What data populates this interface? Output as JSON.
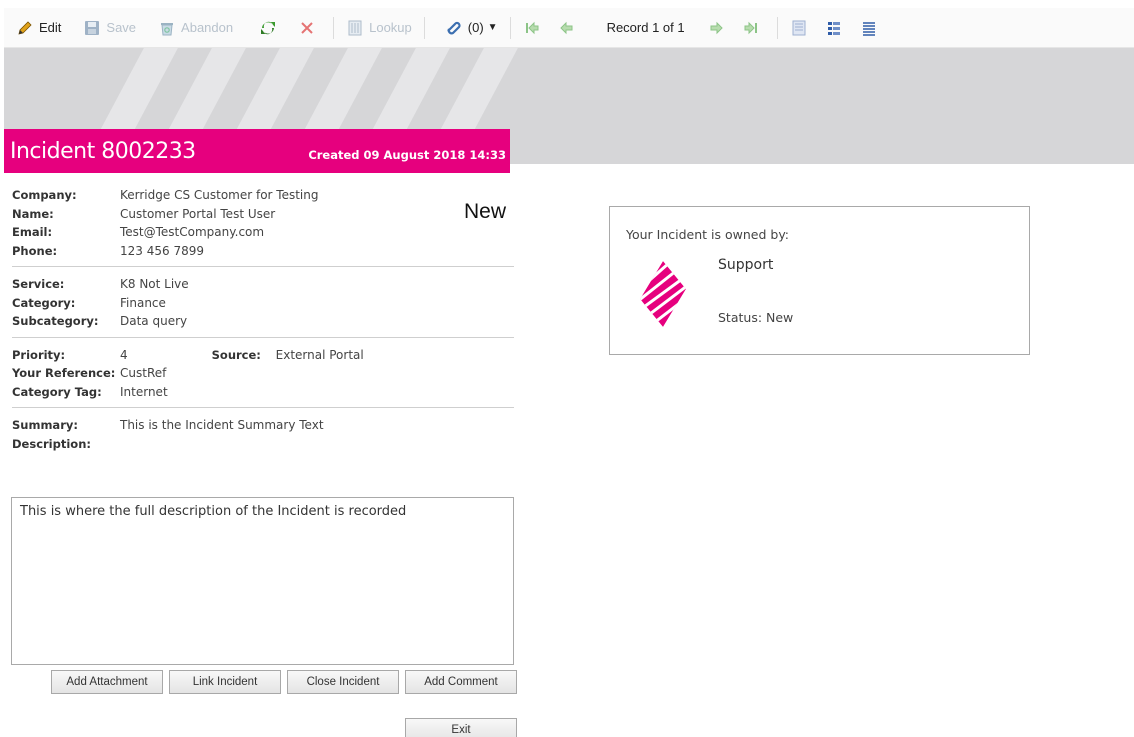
{
  "toolbar": {
    "edit": "Edit",
    "save": "Save",
    "abandon": "Abandon",
    "lookup": "Lookup",
    "attachments": "(0)",
    "record": "Record 1 of 1"
  },
  "colors": {
    "brand": "#e6007e",
    "banner": "#d6d6d8"
  },
  "header": {
    "title": "Incident 8002233",
    "created": "Created 09 August 2018 14:33"
  },
  "status_text": "New",
  "contact": [
    {
      "label": "Company:",
      "value": "Kerridge CS Customer for Testing"
    },
    {
      "label": "Name:",
      "value": "Customer Portal Test User"
    },
    {
      "label": "Email:",
      "value": "Test@TestCompany.com"
    },
    {
      "label": "Phone:",
      "value": "123 456 7899"
    }
  ],
  "service": [
    {
      "label": "Service:",
      "value": "K8 Not Live"
    },
    {
      "label": "Category:",
      "value": "Finance"
    },
    {
      "label": "Subcategory:",
      "value": "Data query"
    }
  ],
  "priority": {
    "label": "Priority:",
    "value": "4",
    "source_label": "Source:",
    "source_value": "External Portal"
  },
  "reference": [
    {
      "label": "Your Reference:",
      "value": "CustRef"
    },
    {
      "label": "Category Tag:",
      "value": "Internet"
    }
  ],
  "summary": {
    "label": "Summary:",
    "value": "This is the Incident Summary Text"
  },
  "description": {
    "label": "Description:",
    "value": "This is where the full description of the Incident is recorded"
  },
  "buttons": {
    "add_attachment": "Add Attachment",
    "link_incident": "Link Incident",
    "close_incident": "Close Incident",
    "add_comment": "Add Comment",
    "exit": "Exit"
  },
  "owner": {
    "title": "Your Incident is owned by:",
    "name": "Support",
    "status": "Status: New"
  }
}
